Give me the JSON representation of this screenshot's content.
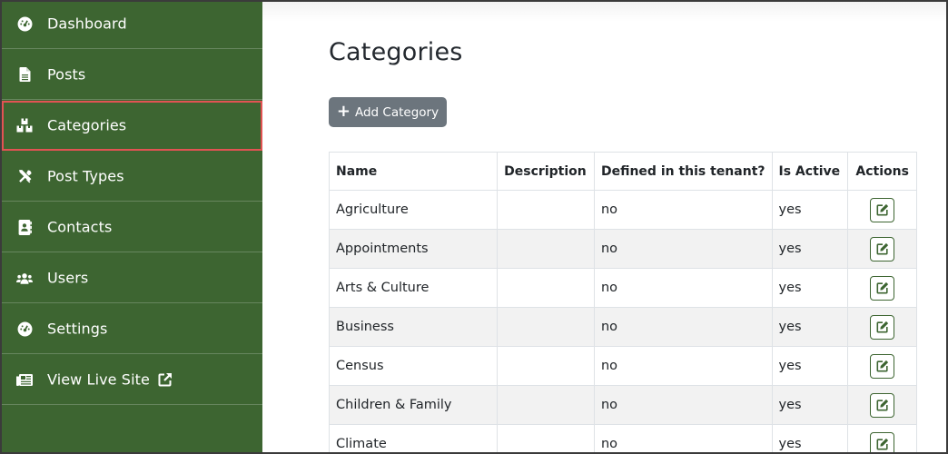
{
  "sidebar": {
    "items": [
      {
        "label": "Dashboard",
        "icon": "dashboard-icon"
      },
      {
        "label": "Posts",
        "icon": "file-icon"
      },
      {
        "label": "Categories",
        "icon": "cubes-icon",
        "active": true
      },
      {
        "label": "Post Types",
        "icon": "tools-icon"
      },
      {
        "label": "Contacts",
        "icon": "address-book-icon"
      },
      {
        "label": "Users",
        "icon": "users-icon"
      },
      {
        "label": "Settings",
        "icon": "dashboard-icon"
      },
      {
        "label": "View Live Site",
        "icon": "newspaper-icon",
        "extra_icon": "external-link-icon"
      }
    ]
  },
  "main": {
    "title": "Categories",
    "add_button_label": "Add Category",
    "table": {
      "headers": [
        "Name",
        "Description",
        "Defined in this tenant?",
        "Is Active",
        "Actions"
      ],
      "rows": [
        {
          "name": "Agriculture",
          "description": "",
          "defined": "no",
          "active": "yes"
        },
        {
          "name": "Appointments",
          "description": "",
          "defined": "no",
          "active": "yes"
        },
        {
          "name": "Arts & Culture",
          "description": "",
          "defined": "no",
          "active": "yes"
        },
        {
          "name": "Business",
          "description": "",
          "defined": "no",
          "active": "yes"
        },
        {
          "name": "Census",
          "description": "",
          "defined": "no",
          "active": "yes"
        },
        {
          "name": "Children & Family",
          "description": "",
          "defined": "no",
          "active": "yes"
        },
        {
          "name": "Climate",
          "description": "",
          "defined": "no",
          "active": "yes"
        }
      ]
    }
  },
  "colors": {
    "sidebar_bg": "#3d6531",
    "active_outline": "#e25353",
    "button_gray": "#6c757d",
    "row_stripe": "#f2f2f2"
  }
}
